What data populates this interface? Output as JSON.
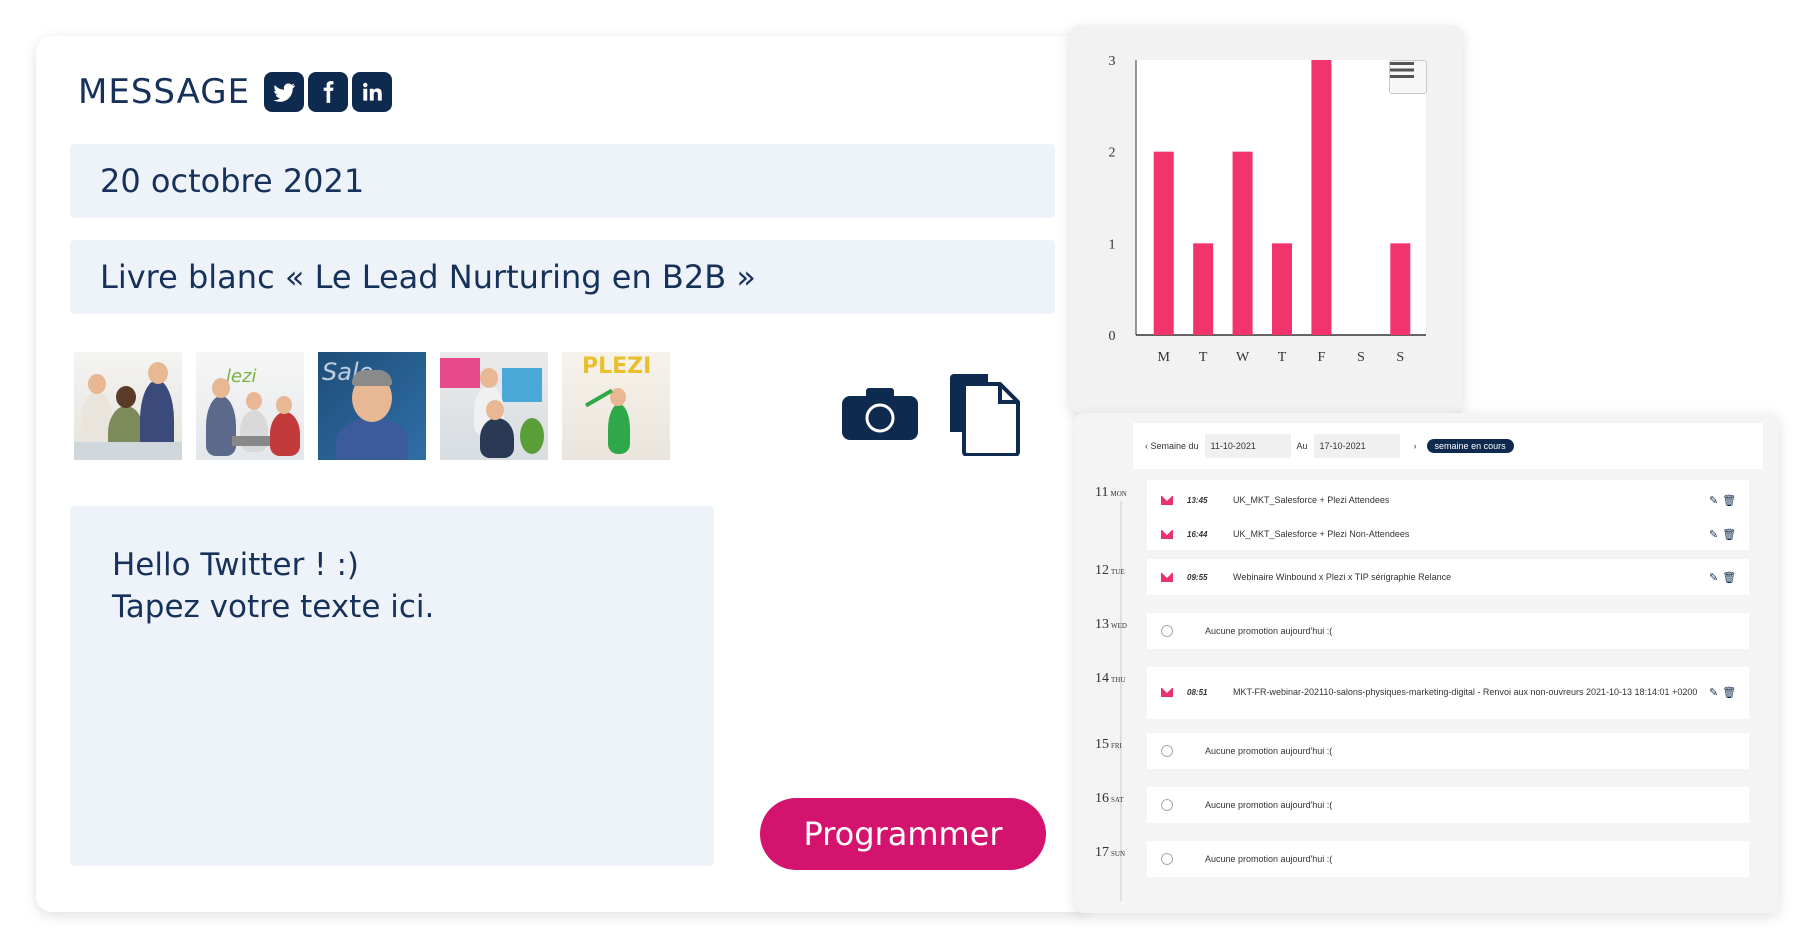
{
  "composer": {
    "title": "MESSAGE",
    "social": [
      "twitter-icon",
      "facebook-icon",
      "linkedin-icon"
    ],
    "date_value": "20 octobre 2021",
    "campaign_value": "Livre blanc « Le Lead Nurturing en B2B »",
    "images": [
      "photo-team-laptop",
      "photo-office-meeting",
      "photo-man-smiling",
      "photo-desk-workers",
      "photo-plezi-balloons"
    ],
    "message_line1": "Hello Twitter ! :)",
    "message_line2": "Tapez votre texte ici.",
    "submit_label": "Programmer",
    "accent": "#d4136e",
    "field_bg": "#eef3fa"
  },
  "chart_data": {
    "type": "bar",
    "categories": [
      "M",
      "T",
      "W",
      "T",
      "F",
      "S",
      "S"
    ],
    "values": [
      2,
      1,
      2,
      1,
      3,
      0,
      1
    ],
    "ylim": [
      0,
      3
    ],
    "yticks": [
      0,
      1,
      2,
      3
    ],
    "color": "#f2346c",
    "title": "",
    "xlabel": "",
    "ylabel": "",
    "grid": false
  },
  "calendar": {
    "week_prev": "‹ Semaine du",
    "week_from": "11-10-2021",
    "week_to_label": "Au",
    "week_to": "17-10-2021",
    "week_next": "›",
    "current_week": "semaine en cours",
    "days": [
      {
        "num": "11",
        "dow": "MON",
        "entries": [
          {
            "time": "13:45",
            "name": "UK_MKT_Salesforce + Plezi Attendees"
          },
          {
            "time": "16:44",
            "name": "UK_MKT_Salesforce + Plezi Non-Attendees"
          }
        ]
      },
      {
        "num": "12",
        "dow": "TUE",
        "entries": [
          {
            "time": "09:55",
            "name": "Webinaire Winbound x Plezi x TIP sérigraphie Relance"
          }
        ]
      },
      {
        "num": "13",
        "dow": "WED",
        "empty": "Aucune promotion aujourd'hui :("
      },
      {
        "num": "14",
        "dow": "THU",
        "entries": [
          {
            "time": "08:51",
            "name": "MKT-FR-webinar-202110-salons-physiques-marketing-digital - Renvoi aux non-ouvreurs 2021-10-13 18:14:01 +0200"
          }
        ]
      },
      {
        "num": "15",
        "dow": "FRI",
        "empty": "Aucune promotion aujourd'hui :("
      },
      {
        "num": "16",
        "dow": "SAT",
        "empty": "Aucune promotion aujourd'hui :("
      },
      {
        "num": "17",
        "dow": "SUN",
        "empty": "Aucune promotion aujourd'hui :("
      }
    ]
  }
}
